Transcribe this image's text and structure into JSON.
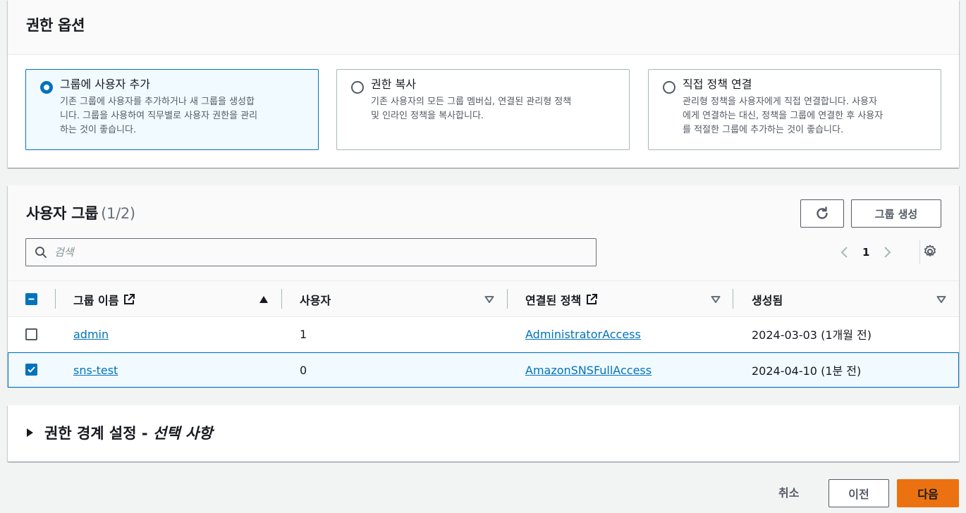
{
  "permission_options": {
    "title": "권한 옵션",
    "options": [
      {
        "title": "그룹에 사용자 추가",
        "desc": [
          "기존 그룹에 사용자를 추가하거나 새 그룹을 생성합",
          "니다. 그룹을 사용하여 직무별로 사용자 권한을 관리",
          "하는 것이 좋습니다."
        ],
        "selected": true
      },
      {
        "title": "권한 복사",
        "desc": [
          "기존 사용자의 모든 그룹 멤버십, 연결된 관리형 정책",
          "및 인라인 정책을 복사합니다."
        ],
        "selected": false
      },
      {
        "title": "직접 정책 연결",
        "desc": [
          "관리형 정책을 사용자에게 직접 연결합니다. 사용자",
          "에게 연결하는 대신, 정책을 그룹에 연결한 후 사용자",
          "를 적절한 그룹에 추가하는 것이 좋습니다."
        ],
        "selected": false
      }
    ]
  },
  "user_groups": {
    "title": "사용자 그룹",
    "count": "(1/2)",
    "create_button": "그룹 생성",
    "search_placeholder": "검색",
    "page": "1",
    "columns": [
      "그룹 이름",
      "사용자",
      "연결된 정책",
      "생성됨"
    ],
    "rows": [
      {
        "name": "admin",
        "users": "1",
        "policy": "AdministratorAccess",
        "created": "2024-03-03 (1개월 전)",
        "checked": false
      },
      {
        "name": "sns-test",
        "users": "0",
        "policy": "AmazonSNSFullAccess",
        "created": "2024-04-10 (1분 전)",
        "checked": true
      }
    ]
  },
  "boundary": {
    "title": "권한 경계 설정 - ",
    "optional": "선택 사항"
  },
  "footer": {
    "cancel": "취소",
    "prev": "이전",
    "next": "다음"
  },
  "colors": {
    "accent": "#0073bb",
    "primary_button": "#ec7211"
  }
}
